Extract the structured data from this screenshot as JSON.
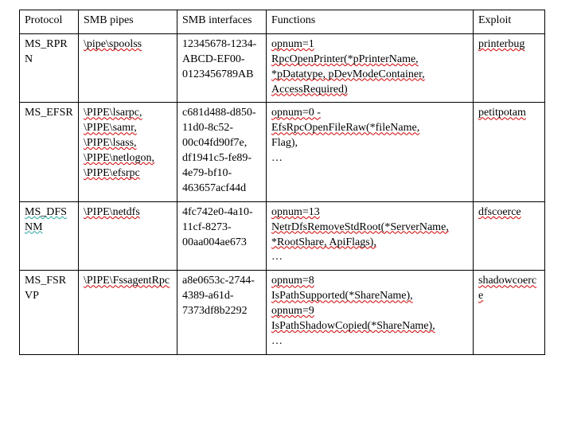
{
  "headers": {
    "protocol": "Protocol",
    "pipes": "SMB pipes",
    "ifaces": "SMB interfaces",
    "funcs": "Functions",
    "exploit": "Exploit"
  },
  "rows": [
    {
      "protocol": "MS_RPRN",
      "pipes": "\\pipe\\spoolss",
      "ifaces": "12345678-1234-ABCD-EF00-0123456789AB",
      "funcs_l1": "opnum=1",
      "funcs_l2": "RpcOpenPrinter(*pPrinterName,",
      "funcs_l3": " *pDatatype, pDevModeContainer,",
      "funcs_l4": "AccessRequired)",
      "exploit": "printerbug"
    },
    {
      "protocol": "MS_EFSR",
      "pipes": "\\PIPE\\lsarpc, \\PIPE\\samr, \\PIPE\\lsass, \\PIPE\\netlogon, \\PIPE\\efsrpc",
      "ifaces": "c681d488-d850-11d0-8c52-00c04fd90f7e, df1941c5-fe89-4e79-bf10-463657acf44d",
      "funcs_l1": "opnum=0 -",
      "funcs_l2": "EfsRpcOpenFileRaw(*fileName,",
      "funcs_l3": "Flag),",
      "funcs_l4": "…",
      "exploit": "petitpotam"
    },
    {
      "protocol": "MS_DFSNM",
      "pipes": "\\PIPE\\netdfs",
      "ifaces": "4fc742e0-4a10-11cf-8273-00aa004ae673",
      "funcs_l1": "opnum=13",
      "funcs_l2": "NetrDfsRemoveStdRoot(*ServerName, *RootShare, ApiFlags),",
      "funcs_l3": "",
      "funcs_l4": "…",
      "exploit": "dfscoerce"
    },
    {
      "protocol": "MS_FSRVP",
      "pipes": "\\PIPE\\FssagentRpc",
      "ifaces": "a8e0653c-2744-4389-a61d-7373df8b2292",
      "funcs_l1": "opnum=8",
      "funcs_l2": "IsPathSupported(*ShareName),",
      "funcs_l3": "opnum=9",
      "funcs_l4": "IsPathShadowCopied(*ShareName),",
      "funcs_l5": "…",
      "exploit": "shadowcoerce"
    }
  ]
}
